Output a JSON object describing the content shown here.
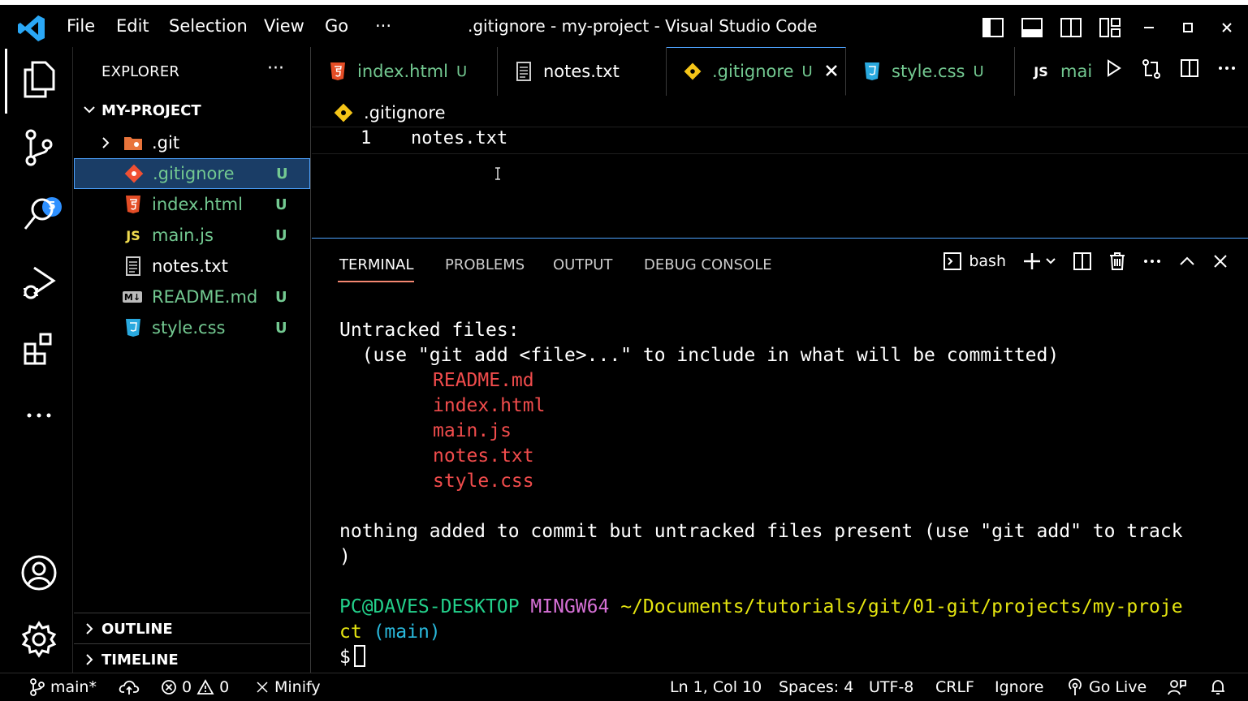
{
  "window": {
    "title": ".gitignore - my-project - Visual Studio Code",
    "menu": [
      "File",
      "Edit",
      "Selection",
      "View",
      "Go",
      "···"
    ]
  },
  "activity_bar": {
    "scm_badge": "5"
  },
  "explorer": {
    "header": "EXPLORER",
    "more": "···",
    "project": "MY-PROJECT",
    "files": [
      {
        "name": ".git",
        "status": "",
        "color": "#ffffff",
        "icon": "folder-git-icon"
      },
      {
        "name": ".gitignore",
        "status": "U",
        "color": "#73c991",
        "icon": "git-diamond-icon"
      },
      {
        "name": "index.html",
        "status": "U",
        "color": "#73c991",
        "icon": "html5-icon"
      },
      {
        "name": "main.js",
        "status": "U",
        "color": "#73c991",
        "icon": "js-icon"
      },
      {
        "name": "notes.txt",
        "status": "",
        "color": "#ffffff",
        "icon": "text-file-icon"
      },
      {
        "name": "README.md",
        "status": "U",
        "color": "#73c991",
        "icon": "markdown-icon"
      },
      {
        "name": "style.css",
        "status": "U",
        "color": "#73c991",
        "icon": "css3-icon"
      }
    ],
    "js_label": "JS",
    "md_label": "M↓",
    "outline": "OUTLINE",
    "timeline": "TIMELINE"
  },
  "tabs": [
    {
      "label": "index.html",
      "status": "U",
      "color": "#73c991",
      "icon": "html5-icon"
    },
    {
      "label": "notes.txt",
      "status": "",
      "color": "#ffffff",
      "icon": "text-file-icon"
    },
    {
      "label": ".gitignore",
      "status": "U",
      "color": "#73c991",
      "icon": "git-diamond-icon"
    },
    {
      "label": "style.css",
      "status": "U",
      "color": "#73c991",
      "icon": "css3-icon"
    },
    {
      "label": "mai",
      "status": "",
      "color": "#73c991",
      "icon": "js-icon"
    }
  ],
  "editor": {
    "breadcrumb": ".gitignore",
    "line_number": "1",
    "line_text": "notes.txt"
  },
  "panel": {
    "tabs": [
      "TERMINAL",
      "PROBLEMS",
      "OUTPUT",
      "DEBUG CONSOLE"
    ],
    "shell": "bash",
    "terminal": {
      "l1": "Untracked files:",
      "l2": "  (use \"git add <file>...\" to include in what will be committed)",
      "untracked": [
        "README.md",
        "index.html",
        "main.js",
        "notes.txt",
        "style.css"
      ],
      "l3": "nothing added to commit but untracked files present (use \"git add\" to track",
      "l4": ")",
      "prompt_user": "PC@DAVES-DESKTOP",
      "prompt_env": "MINGW64",
      "prompt_path": "~/Documents/tutorials/git/01-git/projects/my-proje",
      "prompt_path2": "ct",
      "prompt_branch": "(main)",
      "prompt_symbol": "$"
    }
  },
  "status_bar": {
    "branch": "main*",
    "errors": "0",
    "warnings": "0",
    "minify": "Minify",
    "position": "Ln 1, Col 10",
    "spaces": "Spaces: 4",
    "encoding": "UTF-8",
    "eol": "CRLF",
    "language": "Ignore",
    "go_live": "Go Live"
  },
  "colors": {
    "untracked_green": "#73c991",
    "accent_blue": "#4da3ff",
    "terminal_red": "#f14c4c"
  }
}
